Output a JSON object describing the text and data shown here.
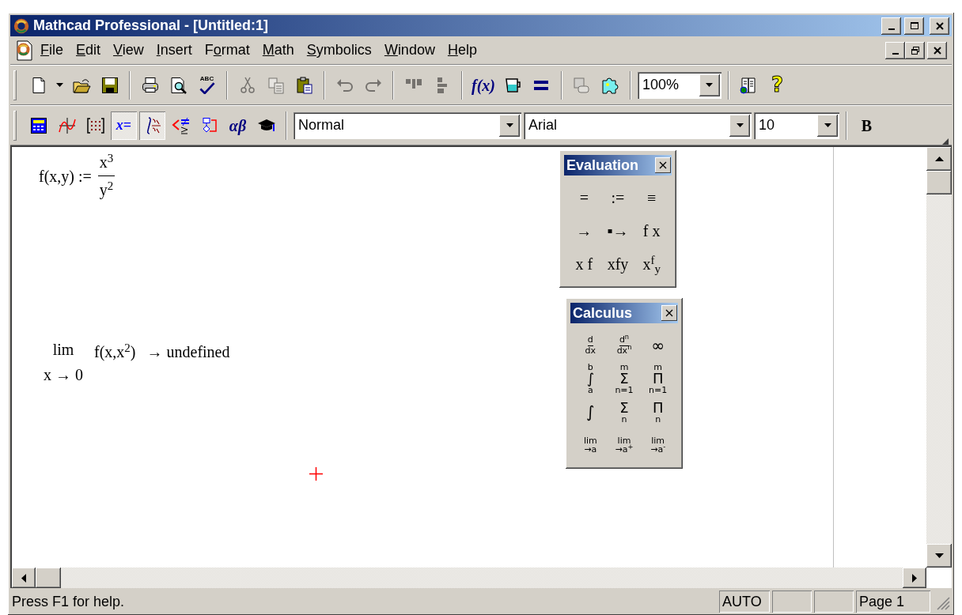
{
  "window": {
    "title": "Mathcad Professional - [Untitled:1]"
  },
  "menu": [
    {
      "key": "F",
      "rest": "ile"
    },
    {
      "key": "E",
      "rest": "dit"
    },
    {
      "key": "V",
      "rest": "iew"
    },
    {
      "key": "I",
      "rest": "nsert"
    },
    {
      "lead": "F",
      "key": "o",
      "rest": "rmat"
    },
    {
      "key": "M",
      "rest": "ath"
    },
    {
      "key": "S",
      "rest": "ymbolics"
    },
    {
      "key": "W",
      "rest": "indow"
    },
    {
      "key": "H",
      "rest": "elp"
    }
  ],
  "standard_toolbar": [
    {
      "kind": "icon",
      "disabled": false
    },
    {
      "kind": "dropdown_arrow"
    },
    {
      "kind": "icon",
      "disabled": false
    },
    {
      "kind": "icon",
      "disabled": false
    },
    {
      "kind": "separator"
    },
    {
      "kind": "icon",
      "disabled": false
    },
    {
      "kind": "icon",
      "disabled": false
    },
    {
      "kind": "labeled",
      "text": "ABC",
      "disabled": false
    },
    {
      "kind": "separator"
    },
    {
      "kind": "icon",
      "disabled": true
    },
    {
      "kind": "icon",
      "disabled": true
    },
    {
      "kind": "icon",
      "disabled": false
    },
    {
      "kind": "separator"
    },
    {
      "kind": "icon",
      "disabled": true
    },
    {
      "kind": "icon",
      "disabled": true
    },
    {
      "kind": "separator"
    },
    {
      "kind": "icon",
      "disabled": true
    },
    {
      "kind": "icon",
      "disabled": true
    },
    {
      "kind": "separator"
    },
    {
      "kind": "text",
      "text": "f(x)",
      "disabled": false
    },
    {
      "kind": "icon",
      "disabled": false
    },
    {
      "kind": "icon",
      "disabled": false
    },
    {
      "kind": "separator"
    },
    {
      "kind": "icon",
      "disabled": true
    },
    {
      "kind": "icon",
      "disabled": false
    },
    {
      "kind": "separator"
    },
    {
      "kind": "combo",
      "value": "100%"
    },
    {
      "kind": "separator"
    },
    {
      "kind": "icon",
      "disabled": false
    },
    {
      "kind": "text",
      "text": "?",
      "disabled": false
    }
  ],
  "math_toolbar": [
    {
      "kind": "icon",
      "pressed": false
    },
    {
      "kind": "icon",
      "pressed": false
    },
    {
      "kind": "icon",
      "pressed": false
    },
    {
      "kind": "text",
      "text": "*x*=",
      "pressed": true
    },
    {
      "kind": "icon",
      "pressed": true
    },
    {
      "kind": "icon",
      "pressed": false
    },
    {
      "kind": "icon",
      "pressed": false
    },
    {
      "kind": "text",
      "text": "αβ",
      "pressed": false
    },
    {
      "kind": "icon",
      "pressed": false
    },
    {
      "kind": "separator"
    },
    {
      "kind": "combo",
      "value": "Normal"
    },
    {
      "kind": "combo",
      "value": "Arial"
    },
    {
      "kind": "combo",
      "value": "10"
    },
    {
      "kind": "separator"
    },
    {
      "kind": "text",
      "text": "B",
      "pressed": false
    }
  ],
  "worksheet": {
    "regions": [
      {
        "kind": "definition",
        "lhs": "f(x,y) :=",
        "numerator": "x$^{3}$",
        "denominator": "y$^{2}$"
      },
      {
        "kind": "limit",
        "operator": "lim",
        "approach": "x → 0",
        "expression": "f(x,x$^{2}$)",
        "result": "→ undefined"
      }
    ]
  },
  "palettes": [
    {
      "title": "Evaluation",
      "buttons": [
        {
          "kind": "symbol",
          "text": "="
        },
        {
          "kind": "symbol",
          "text": ":="
        },
        {
          "kind": "symbol",
          "text": "≡"
        },
        {
          "kind": "symbol",
          "text": "→"
        },
        {
          "kind": "symbol",
          "text": "▪→"
        },
        {
          "kind": "symbol",
          "text": "f x"
        },
        {
          "kind": "symbol",
          "text": "x f"
        },
        {
          "kind": "symbol",
          "text": "xfy"
        },
        {
          "kind": "symbol",
          "text": "x$^{f}$$_{y}$"
        }
      ]
    },
    {
      "title": "Calculus",
      "buttons": [
        {
          "kind": "fraction",
          "top": "d",
          "bottom": "dx"
        },
        {
          "kind": "fraction",
          "top": "d$^{n}$",
          "bottom": "dx$^{n}$"
        },
        {
          "kind": "symbol",
          "text": "∞"
        },
        {
          "kind": "operator",
          "symbol": "∫",
          "upper": "b",
          "lower": "a"
        },
        {
          "kind": "operator",
          "symbol": "Σ",
          "upper": "m",
          "lower": "n=1"
        },
        {
          "kind": "operator",
          "symbol": "Π",
          "upper": "m",
          "lower": "n=1"
        },
        {
          "kind": "symbol",
          "text": "∫"
        },
        {
          "kind": "operator",
          "symbol": "Σ",
          "lower": "n"
        },
        {
          "kind": "operator",
          "symbol": "Π",
          "lower": "n"
        },
        {
          "kind": "limit",
          "top": "lim",
          "bottom": "→a"
        },
        {
          "kind": "limit",
          "top": "lim",
          "bottom": "→a$^{+}$"
        },
        {
          "kind": "limit",
          "top": "lim",
          "bottom": "→a$^{-}$"
        }
      ]
    }
  ],
  "status_bar": {
    "message": "Press F1 for help.",
    "panels": [
      "AUTO",
      "Page 1"
    ]
  }
}
